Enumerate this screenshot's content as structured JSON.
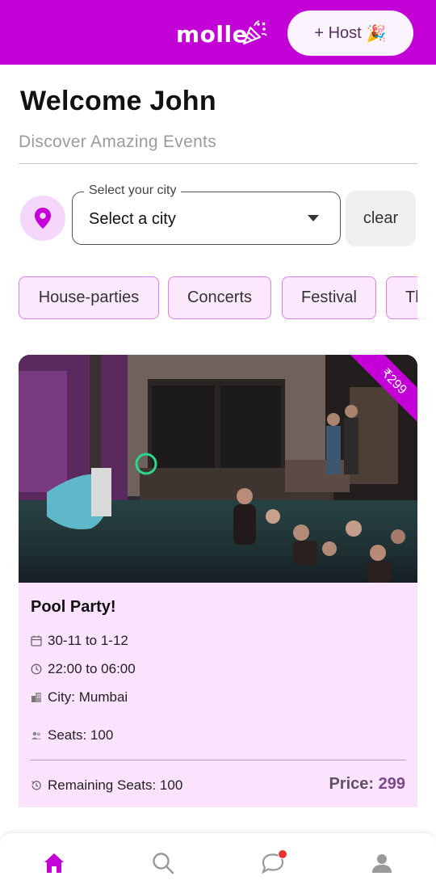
{
  "header": {
    "logo_text": "molle",
    "host_button_label": "+ Host",
    "host_button_emoji": "🎉"
  },
  "welcome": {
    "title": "Welcome John",
    "subtitle": "Discover Amazing Events"
  },
  "city_select": {
    "label": "Select your city",
    "value": "Select a city",
    "clear_label": "clear"
  },
  "categories": [
    "House-parties",
    "Concerts",
    "Festival",
    "Th"
  ],
  "event_card": {
    "price_ribbon": "₹299",
    "title": "Pool Party!",
    "dates": "30-11 to 1-12",
    "time": "22:00 to 06:00",
    "city": "City: Mumbai",
    "seats": "Seats: 100",
    "remaining_seats": "Remaining Seats: 100",
    "price_label": "Price:",
    "price_value": "299"
  },
  "bottom_nav": {
    "items": [
      "home-icon",
      "search-icon",
      "chat-icon",
      "profile-icon"
    ],
    "active": "home-icon"
  },
  "colors": {
    "brand": "#c300d6",
    "chip_bg": "#fbe8fd",
    "chip_border": "#e07ff0",
    "card_bg": "#fbe2fd"
  }
}
